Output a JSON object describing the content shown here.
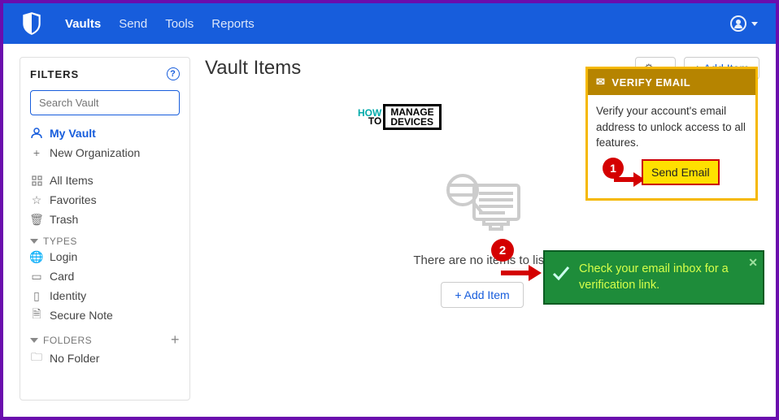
{
  "nav": {
    "items": [
      "Vaults",
      "Send",
      "Tools",
      "Reports"
    ],
    "activeIndex": 0
  },
  "sidebar": {
    "title": "FILTERS",
    "search_placeholder": "Search Vault",
    "my_vault": "My Vault",
    "new_org": "New Organization",
    "all_items": "All Items",
    "favorites": "Favorites",
    "trash": "Trash",
    "types_head": "TYPES",
    "login": "Login",
    "card": "Card",
    "identity": "Identity",
    "secure_note": "Secure Note",
    "folders_head": "FOLDERS",
    "no_folder": "No Folder"
  },
  "main": {
    "title": "Vault Items",
    "add_item": "+ Add Item",
    "empty_text": "There are no items to list.",
    "add_item_center": "+  Add Item"
  },
  "watermark": {
    "how": "HOW",
    "to": "TO",
    "manage": "MANAGE",
    "devices": "DEVICES"
  },
  "verify": {
    "head": "VERIFY EMAIL",
    "body": "Verify your account's email address to unlock access to all features.",
    "send": "Send Email"
  },
  "annot": {
    "one": "1",
    "two": "2"
  },
  "toast": {
    "text": "Check your email inbox for a verification link.",
    "close": "✕"
  }
}
